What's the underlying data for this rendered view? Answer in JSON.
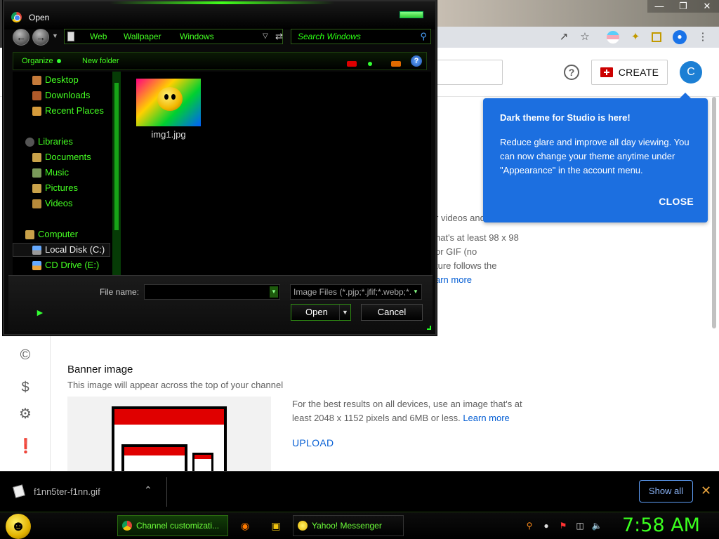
{
  "dialog": {
    "title": "Open",
    "breadcrumb": [
      "Web",
      "Wallpaper",
      "Windows"
    ],
    "search_placeholder": "Search Windows",
    "toolbar": {
      "organize": "Organize",
      "new_folder": "New folder"
    },
    "nav_items": [
      {
        "label": "Desktop",
        "icon": "desktop-icon"
      },
      {
        "label": "Downloads",
        "icon": "downloads-icon"
      },
      {
        "label": "Recent Places",
        "icon": "recent-places-icon"
      },
      {
        "label": "Libraries",
        "icon": "libraries-icon"
      },
      {
        "label": "Documents",
        "icon": "documents-icon"
      },
      {
        "label": "Music",
        "icon": "music-icon"
      },
      {
        "label": "Pictures",
        "icon": "pictures-icon"
      },
      {
        "label": "Videos",
        "icon": "videos-icon"
      },
      {
        "label": "Computer",
        "icon": "computer-icon"
      },
      {
        "label": "Local Disk (C:)",
        "icon": "disk-icon",
        "selected": true
      },
      {
        "label": "CD Drive (E:)",
        "icon": "cd-drive-icon"
      }
    ],
    "files": [
      {
        "name": "img1.jpg"
      }
    ],
    "file_name_label": "File name:",
    "file_name_value": "",
    "filter": "Image Files (*.pjp;*.jfif;*.webp;*.",
    "open_label": "Open",
    "cancel_label": "Cancel"
  },
  "studio": {
    "create_label": "CREATE",
    "avatar_letter": "C",
    "tooltip": {
      "title": "Dark theme for Studio is here!",
      "body": "Reduce glare and improve all day viewing. You can now change your theme anytime under \"Appearance\" in the account menu.",
      "close_label": "CLOSE"
    },
    "picture_text": [
      "r videos and",
      "hat's at least 98 x 98",
      "or GIF (no",
      "ture follows the"
    ],
    "picture_learn_more": "arn more",
    "banner": {
      "title": "Banner image",
      "subtitle": "This image will appear across the top of your channel",
      "desc_line1": "For the best results on all devices, use an image that's at",
      "desc_line2": "least 2048 x 1152 pixels and 6MB or less.",
      "learn_more": "Learn more",
      "upload_label": "UPLOAD"
    }
  },
  "download_bar": {
    "file_name": "f1nn5ter-f1nn.gif",
    "show_all_label": "Show all"
  },
  "taskbar": {
    "buttons": [
      {
        "label": "Channel customizati...",
        "icon": "chrome-icon"
      },
      {
        "label": "Yahoo! Messenger",
        "icon": "yahoo-messenger-icon"
      }
    ],
    "clock": "7:58 AM"
  },
  "colors": {
    "accent_green": "#44ff22",
    "studio_blue": "#1c6fe0",
    "link_blue": "#065fd4",
    "create_red": "#cc0000"
  }
}
